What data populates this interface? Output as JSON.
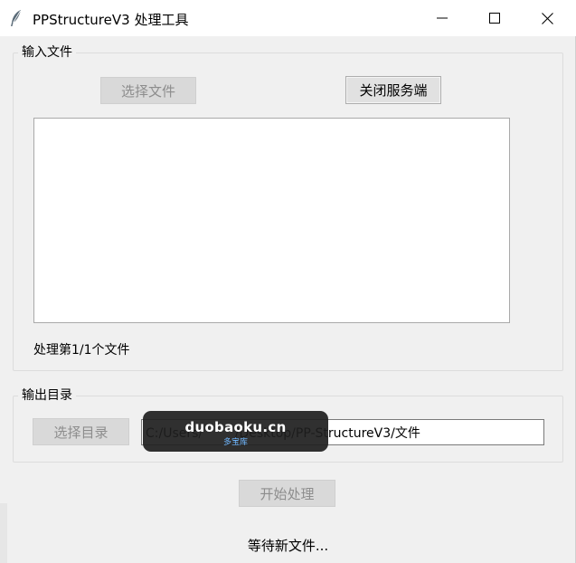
{
  "window": {
    "title": "PPStructureV3 处理工具",
    "icon": "feather-icon",
    "controls": {
      "minimize": "minimize-icon",
      "maximize": "maximize-icon",
      "close": "close-icon"
    }
  },
  "input_group": {
    "legend": "输入文件",
    "select_file_label": "选择文件",
    "close_service_label": "关闭服务端",
    "file_list_items": [],
    "progress_text": "处理第1/1个文件"
  },
  "output_group": {
    "legend": "输出目录",
    "select_dir_label": "选择目录",
    "path_value": "C:/Users/        /Desktop/PP-StructureV3/文件"
  },
  "actions": {
    "start_label": "开始处理"
  },
  "status": {
    "text": "等待新文件..."
  },
  "watermark": {
    "main": "duobaoku.cn",
    "sub": "多宝库"
  },
  "colors": {
    "window_bg": "#f0f0f0",
    "titlebar_bg": "#ffffff",
    "disabled_button_bg": "#d9d9d9",
    "disabled_text": "#8d8d8d",
    "watermark_bg": "#1e1e1e",
    "watermark_sub": "#6fb7ff"
  }
}
